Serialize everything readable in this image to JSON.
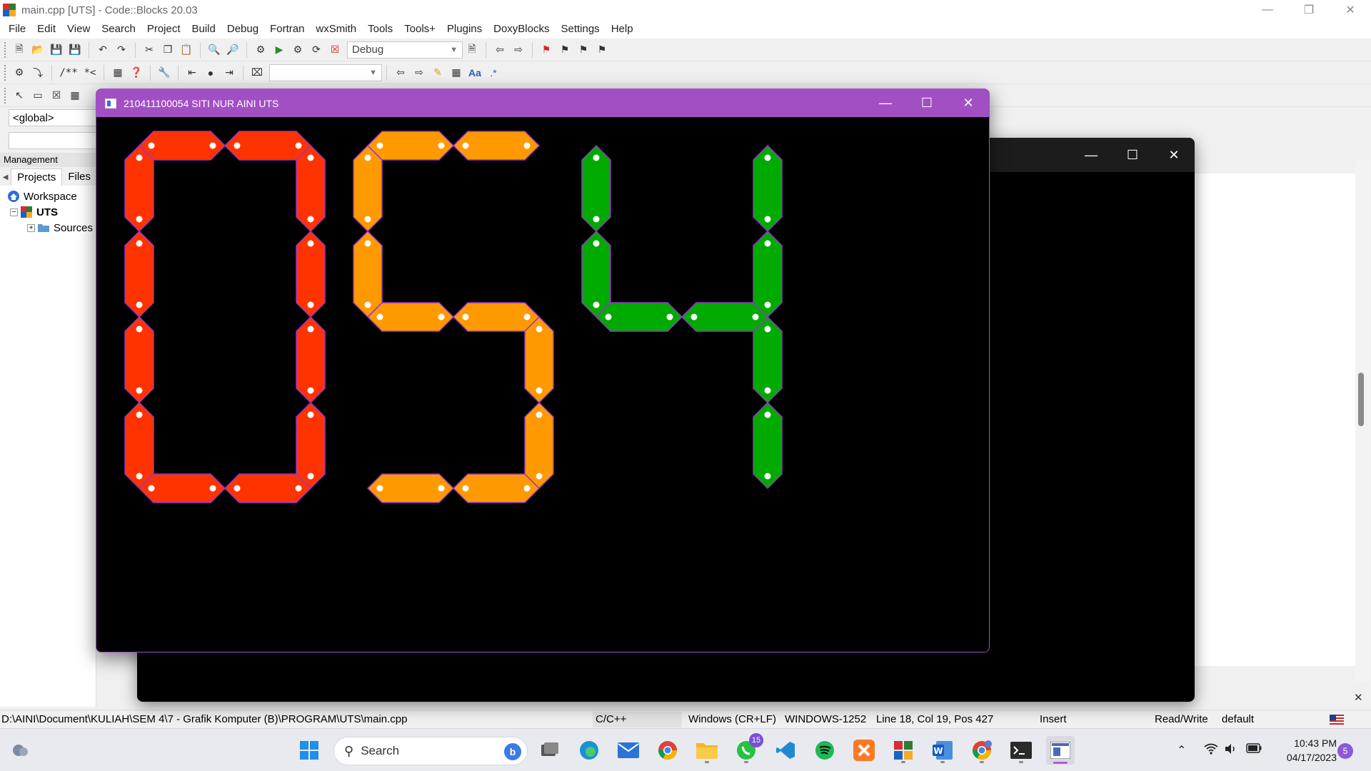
{
  "codeblocks": {
    "title": "main.cpp [UTS] - Code::Blocks 20.03",
    "menu": [
      "File",
      "Edit",
      "View",
      "Search",
      "Project",
      "Build",
      "Debug",
      "Fortran",
      "wxSmith",
      "Tools",
      "Tools+",
      "Plugins",
      "DoxyBlocks",
      "Settings",
      "Help"
    ],
    "build_target": "Debug",
    "scope": "<global>",
    "management_header": "Management",
    "tabs": [
      "Projects",
      "Files"
    ],
    "tree": {
      "workspace": "Workspace",
      "project": "UTS",
      "sources": "Sources"
    },
    "statusbar": {
      "path": "D:\\AINI\\Document\\KULIAH\\SEM 4\\7 - Grafik Komputer (B)\\PROGRAM\\UTS\\main.cpp",
      "language": "C/C++",
      "line_endings": "Windows (CR+LF)",
      "encoding": "WINDOWS-1252",
      "position": "Line 18, Col 19, Pos 427",
      "mode": "Insert",
      "access": "Read/Write",
      "profile": "default"
    }
  },
  "graphics_window": {
    "title": "210411100054 SITI NUR AINI UTS",
    "digits": [
      {
        "value": "0",
        "color": "#ff3300"
      },
      {
        "value": "5",
        "color": "#ff9900"
      },
      {
        "value": "4",
        "color": "#00aa00"
      }
    ],
    "outline_color": "#9933cc",
    "dot_color": "#ffffff"
  },
  "taskbar": {
    "search_label": "Search",
    "whatsapp_badge": "15",
    "time": "10:43 PM",
    "date": "04/17/2023",
    "notification_count": "5"
  }
}
